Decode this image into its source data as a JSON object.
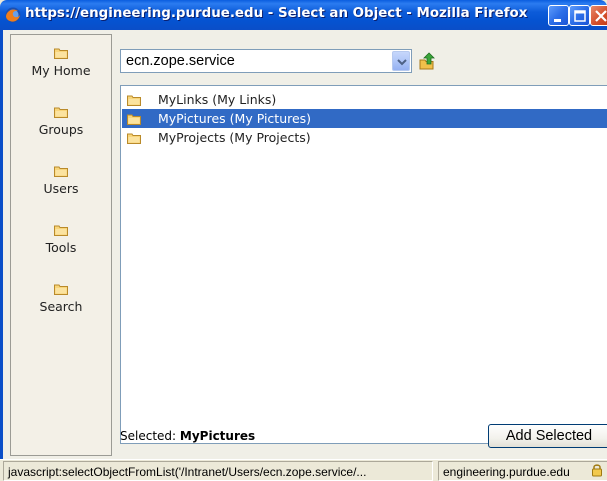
{
  "window": {
    "title": "https://engineering.purdue.edu - Select an Object - Mozilla Firefox",
    "app_icon": "firefox-icon"
  },
  "sidebar": {
    "items": [
      {
        "label": "My Home",
        "icon": "folder-icon"
      },
      {
        "label": "Groups",
        "icon": "folder-icon"
      },
      {
        "label": "Users",
        "icon": "folder-icon"
      },
      {
        "label": "Tools",
        "icon": "folder-icon"
      },
      {
        "label": "Search",
        "icon": "folder-icon"
      }
    ]
  },
  "location": {
    "selected_value": "ecn.zope.service",
    "up_icon": "up-folder-icon"
  },
  "filelist": {
    "items": [
      {
        "label": "MyLinks (My Links)",
        "selected": false
      },
      {
        "label": "MyPictures (My Pictures)",
        "selected": true
      },
      {
        "label": "MyProjects (My Projects)",
        "selected": false
      }
    ]
  },
  "footer": {
    "selected_prefix": "Selected:",
    "selected_value": "MyPictures",
    "add_button_label": "Add Selected"
  },
  "statusbar": {
    "left_text": "javascript:selectObjectFromList('/Intranet/Users/ecn.zope.service/...",
    "right_text": "engineering.purdue.edu",
    "lock_icon": "lock-icon"
  },
  "colors": {
    "titlebar": "#0a5ddf",
    "selection": "#316ac5",
    "folder": "#f7c667"
  }
}
